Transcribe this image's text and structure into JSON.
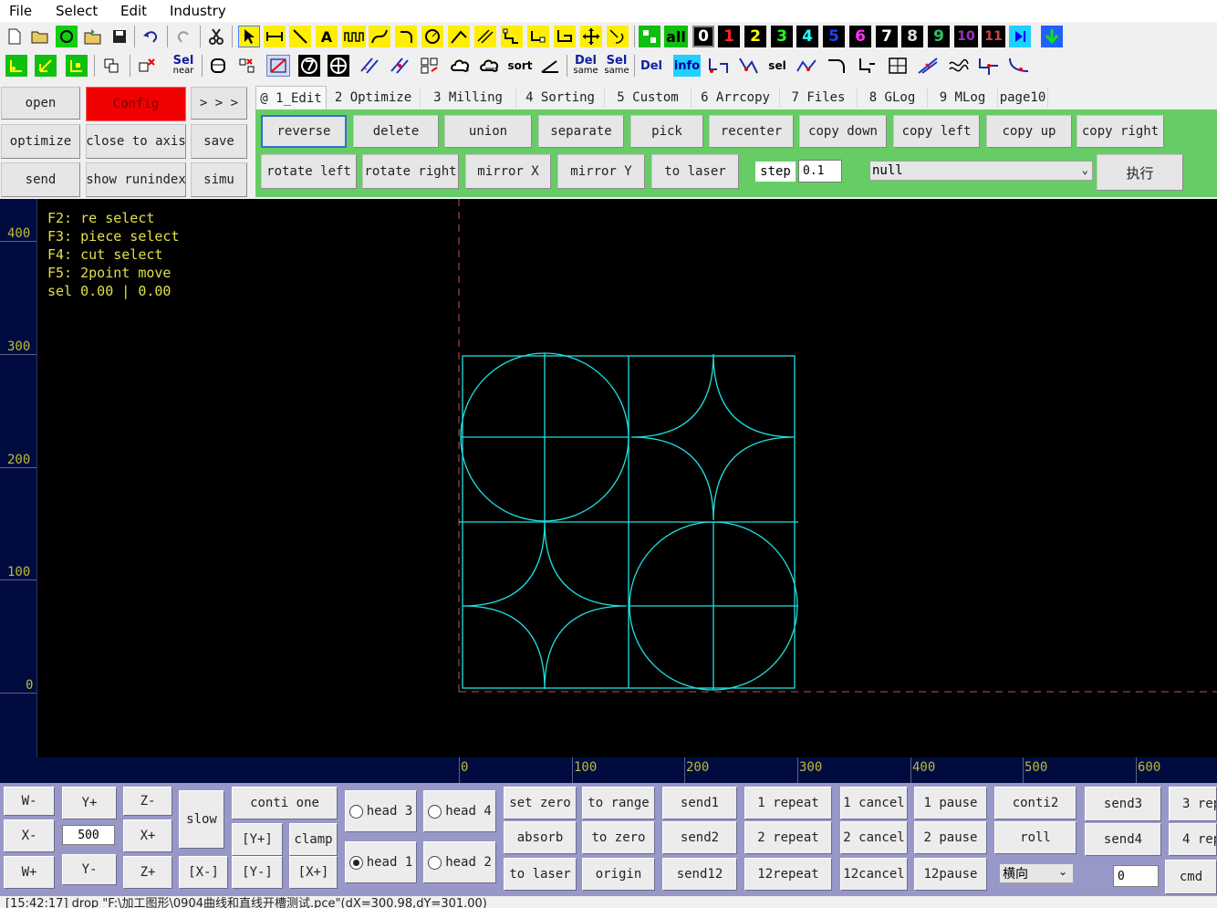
{
  "menu": [
    "File",
    "Select",
    "Edit",
    "Industry"
  ],
  "toolbar1": {
    "num_labels": [
      "0",
      "1",
      "2",
      "3",
      "4",
      "5",
      "6",
      "7",
      "8",
      "9",
      "10",
      "11"
    ],
    "all_label": "all"
  },
  "toolbar2": {
    "sel_near": [
      "Sel",
      "near"
    ],
    "sort": "sort",
    "del_same": [
      "Del",
      "same"
    ],
    "sel_same": [
      "Sel",
      "same"
    ],
    "del": "Del",
    "info": "info",
    "sel": "sel"
  },
  "left_buttons": {
    "open": "open",
    "config": "Config",
    "more": "> > >",
    "optimize": "optimize",
    "close_to_axis": "close to axis",
    "save": "save",
    "send": "send",
    "show_runindex": "show runindex",
    "simu": "simu"
  },
  "tabs": [
    "@ 1_Edit",
    "2 Optimize",
    "3 Milling",
    "4 Sorting",
    "5 Custom",
    "6 Arrcopy",
    "7 Files",
    "8 GLog",
    "9 MLog",
    "page10"
  ],
  "edit_panel": {
    "row1": [
      "reverse",
      "delete",
      "union",
      "separate",
      "pick",
      "recenter",
      "copy down",
      "copy left",
      "copy up",
      "copy right"
    ],
    "row2": [
      "rotate left",
      "rotate right",
      "mirror X",
      "mirror Y",
      "to laser"
    ],
    "step_label": "step",
    "step_value": "0.1",
    "combo_value": "null",
    "execute": "执行"
  },
  "canvas": {
    "help": [
      "F2: re select",
      "F3: piece select",
      "F4: cut select",
      "F5: 2point move",
      "sel 0.00 | 0.00"
    ],
    "y_ticks": [
      "400",
      "300",
      "200",
      "100",
      "0"
    ],
    "x_ticks": [
      "0",
      "100",
      "200",
      "300",
      "400",
      "500",
      "600"
    ]
  },
  "bottom": {
    "w_minus": "W-",
    "y_plus": "Y+",
    "z_minus": "Z-",
    "x_minus": "X-",
    "step_value": "500",
    "x_plus": "X+",
    "w_plus": "W+",
    "y_minus": "Y-",
    "z_plus": "Z+",
    "slow": "slow",
    "conti_one": "conti one",
    "y_plus_b": "[Y+]",
    "clamp": "clamp",
    "x_minus_b": "[X-]",
    "y_minus_b": "[Y-]",
    "x_plus_b": "[X+]",
    "head3": "head 3",
    "head4": "head 4",
    "head1": "head 1",
    "head2": "head 2",
    "set_zero": "set zero",
    "to_range": "to range",
    "send1": "send1",
    "repeat1": "1 repeat",
    "cancel1": "1 cancel",
    "pause1": "1 pause",
    "conti2": "conti2",
    "send3": "send3",
    "rep3": "3 rep",
    "absorb": "absorb",
    "to_zero": "to zero",
    "send2": "send2",
    "repeat2": "2 repeat",
    "cancel2": "2 cancel",
    "pause2": "2 pause",
    "roll": "roll",
    "send4": "send4",
    "rep4": "4 rep",
    "to_laser": "to laser",
    "origin": "origin",
    "send12": "send12",
    "repeat12": "12repeat",
    "cancel12": "12cancel",
    "pause12": "12pause",
    "direction": "横向",
    "cmd_value": "0",
    "cmd": "cmd"
  },
  "status": "[15:42:17] drop \"F:\\加工图形\\0904曲线和直线开槽测试.pce\"(dX=300.98,dY=301.00)"
}
